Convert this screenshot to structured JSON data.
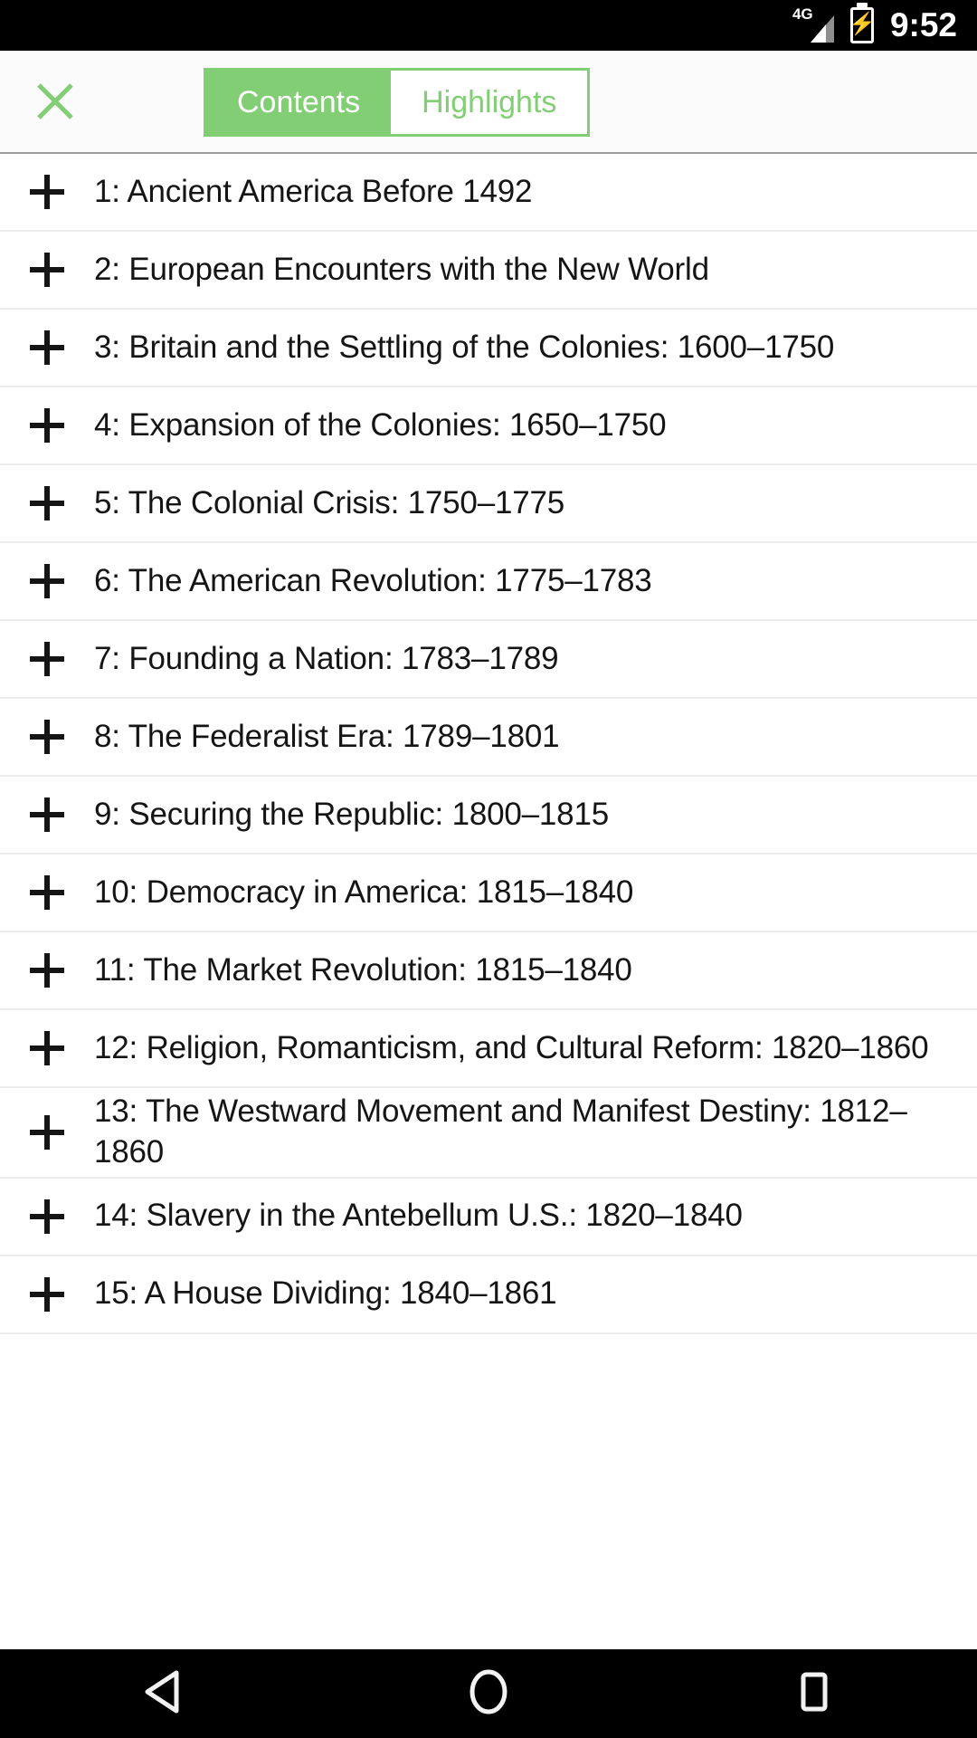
{
  "status_bar": {
    "network_label": "4G",
    "signal_icon": "signal-bars-icon",
    "battery_icon": "battery-charging-icon",
    "battery_bolt": "⚡",
    "time": "9:52"
  },
  "header": {
    "close_icon": "close-icon",
    "tabs": [
      {
        "label": "Contents",
        "active": true
      },
      {
        "label": "Highlights",
        "active": false
      }
    ]
  },
  "colors": {
    "accent_green": "#82ce74",
    "row_divider": "#ededed",
    "header_bg": "#fbfbfb",
    "text": "#151515"
  },
  "contents": {
    "expand_icon": "plus-icon",
    "chapters": [
      {
        "title": "1: Ancient America Before 1492"
      },
      {
        "title": "2: European Encounters with the New World"
      },
      {
        "title": "3: Britain and the Settling of the Colonies: 1600–1750"
      },
      {
        "title": "4: Expansion of the Colonies: 1650–1750"
      },
      {
        "title": "5: The Colonial Crisis: 1750–1775"
      },
      {
        "title": "6: The American Revolution: 1775–1783"
      },
      {
        "title": "7: Founding a Nation: 1783–1789"
      },
      {
        "title": "8: The Federalist Era: 1789–1801"
      },
      {
        "title": "9: Securing the Republic: 1800–1815"
      },
      {
        "title": "10: Democracy in America: 1815–1840"
      },
      {
        "title": "11: The Market Revolution: 1815–1840"
      },
      {
        "title": "12: Religion, Romanticism, and Cultural Reform: 1820–1860"
      },
      {
        "title": "13: The Westward Movement and Manifest Destiny: 1812–1860"
      },
      {
        "title": "14: Slavery in the Antebellum U.S.: 1820–1840"
      },
      {
        "title": "15: A House Dividing: 1840–1861"
      }
    ]
  },
  "nav_bar": {
    "buttons": [
      {
        "icon": "back-triangle-icon"
      },
      {
        "icon": "home-circle-icon"
      },
      {
        "icon": "recents-square-icon"
      }
    ]
  }
}
